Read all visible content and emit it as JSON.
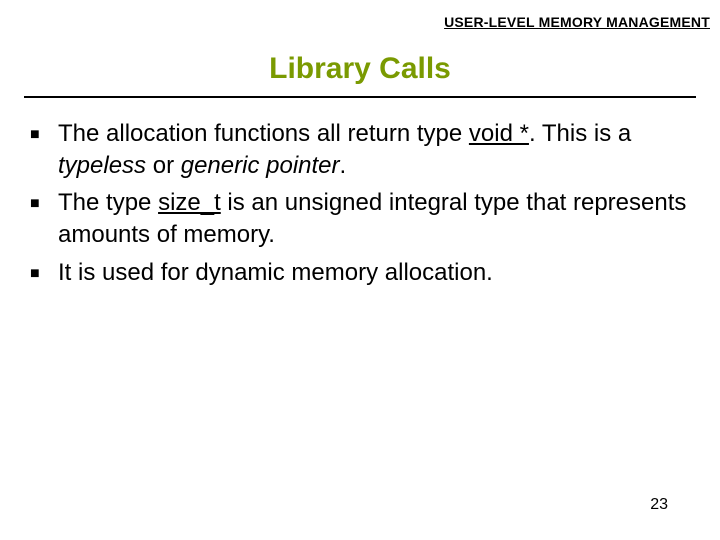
{
  "header": "USER-LEVEL MEMORY MANAGEMENT",
  "title": "Library Calls",
  "bullets": [
    {
      "parts": [
        {
          "t": "The allocation functions all return type "
        },
        {
          "t": "void *",
          "u": true
        },
        {
          "t": ". This is a "
        },
        {
          "t": "typeless",
          "i": true
        },
        {
          "t": " or "
        },
        {
          "t": "generic pointer",
          "i": true
        },
        {
          "t": "."
        }
      ]
    },
    {
      "parts": [
        {
          "t": "The type "
        },
        {
          "t": "size_t",
          "u": true
        },
        {
          "t": " is an unsigned integral type that represents amounts of memory."
        }
      ]
    },
    {
      "parts": [
        {
          "t": "It is used for dynamic memory allocation."
        }
      ]
    }
  ],
  "page_number": "23"
}
